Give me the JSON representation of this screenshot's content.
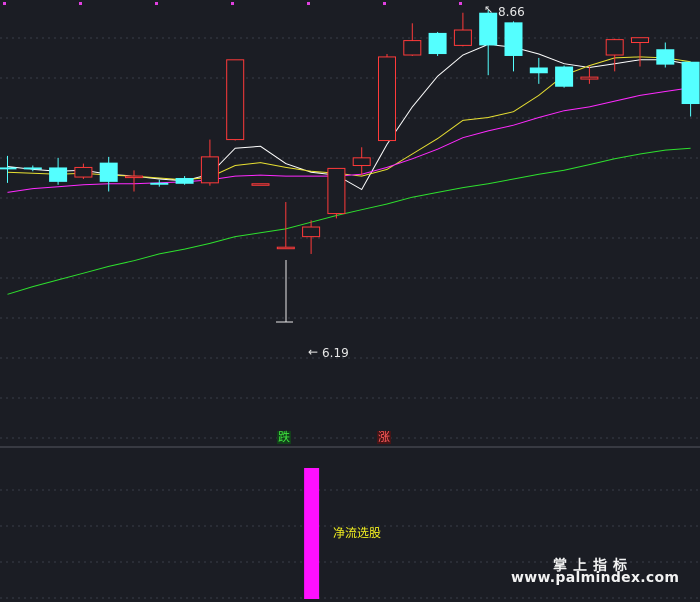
{
  "chart_data": [
    {
      "type": "candlestick",
      "title": "",
      "y_range": [
        4.6,
        8.7
      ],
      "up_color": "#ff3a3a",
      "down_color": "#54ffff",
      "candles": [
        {
          "open": 7.02,
          "close": 7.0,
          "high": 7.14,
          "low": 6.86
        },
        {
          "open": 7.02,
          "close": 7.0,
          "high": 7.04,
          "low": 6.98
        },
        {
          "open": 7.02,
          "close": 6.87,
          "high": 7.12,
          "low": 6.84
        },
        {
          "open": 6.92,
          "close": 7.02,
          "high": 7.06,
          "low": 6.9
        },
        {
          "open": 7.07,
          "close": 6.87,
          "high": 7.13,
          "low": 6.77
        },
        {
          "open": 6.92,
          "close": 6.93,
          "high": 6.99,
          "low": 6.77
        },
        {
          "open": 6.86,
          "close": 6.84,
          "high": 6.89,
          "low": 6.82
        },
        {
          "open": 6.91,
          "close": 6.85,
          "high": 6.93,
          "low": 6.84
        },
        {
          "open": 6.86,
          "close": 7.13,
          "high": 7.31,
          "low": 6.83
        },
        {
          "open": 7.31,
          "close": 8.14,
          "high": 8.14,
          "low": 7.3
        },
        {
          "open": 6.85,
          "close": 6.85,
          "high": 6.85,
          "low": 6.85
        },
        {
          "open": 6.19,
          "close": 6.19,
          "high": 6.66,
          "low": 6.19
        },
        {
          "open": 6.3,
          "close": 6.4,
          "high": 6.47,
          "low": 6.12
        },
        {
          "open": 6.54,
          "close": 7.01,
          "high": 7.01,
          "low": 6.49
        },
        {
          "open": 7.04,
          "close": 7.12,
          "high": 7.23,
          "low": 6.94
        },
        {
          "open": 7.3,
          "close": 8.17,
          "high": 8.2,
          "low": 7.3
        },
        {
          "open": 8.19,
          "close": 8.34,
          "high": 8.52,
          "low": 8.18
        },
        {
          "open": 8.42,
          "close": 8.2,
          "high": 8.43,
          "low": 8.18
        },
        {
          "open": 8.29,
          "close": 8.45,
          "high": 8.63,
          "low": 8.28
        },
        {
          "open": 8.63,
          "close": 8.29,
          "high": 8.66,
          "low": 7.98
        },
        {
          "open": 8.53,
          "close": 8.18,
          "high": 8.54,
          "low": 8.02
        },
        {
          "open": 8.06,
          "close": 8.0,
          "high": 8.16,
          "low": 7.89
        },
        {
          "open": 8.07,
          "close": 7.86,
          "high": 8.08,
          "low": 7.85
        },
        {
          "open": 7.94,
          "close": 7.96,
          "high": 8.07,
          "low": 7.89
        },
        {
          "open": 8.19,
          "close": 8.35,
          "high": 8.36,
          "low": 8.02
        },
        {
          "open": 8.32,
          "close": 8.37,
          "high": 8.37,
          "low": 8.07
        },
        {
          "open": 8.25,
          "close": 8.09,
          "high": 8.32,
          "low": 8.06
        },
        {
          "open": 8.12,
          "close": 7.68,
          "high": 8.12,
          "low": 7.55
        }
      ],
      "series": [
        {
          "color": "#ffffff",
          "values": [
            7.03,
            7.0,
            6.98,
            6.99,
            6.95,
            6.93,
            6.9,
            6.88,
            6.95,
            7.22,
            7.24,
            7.06,
            6.97,
            6.94,
            6.79,
            7.26,
            7.65,
            7.97,
            8.19,
            8.3,
            8.27,
            8.2,
            8.1,
            8.06,
            8.1,
            8.14,
            8.14,
            8.09
          ]
        },
        {
          "color": "#e8e032",
          "values": [
            6.97,
            6.96,
            6.95,
            6.96,
            6.94,
            6.93,
            6.91,
            6.89,
            6.92,
            7.04,
            7.07,
            7.02,
            6.98,
            6.96,
            6.93,
            7.0,
            7.16,
            7.32,
            7.51,
            7.54,
            7.6,
            7.77,
            7.98,
            8.08,
            8.16,
            8.17,
            8.16,
            8.12
          ]
        },
        {
          "color": "#ff2aff",
          "values": [
            6.76,
            6.8,
            6.82,
            6.84,
            6.85,
            6.85,
            6.86,
            6.87,
            6.89,
            6.93,
            6.94,
            6.93,
            6.93,
            6.93,
            6.95,
            7.02,
            7.11,
            7.21,
            7.33,
            7.4,
            7.46,
            7.54,
            7.61,
            7.65,
            7.71,
            7.77,
            7.81,
            7.85
          ]
        },
        {
          "color": "#2ee02e",
          "values": [
            5.7,
            5.78,
            5.85,
            5.92,
            5.99,
            6.05,
            6.12,
            6.17,
            6.23,
            6.3,
            6.34,
            6.38,
            6.45,
            6.52,
            6.58,
            6.64,
            6.71,
            6.76,
            6.81,
            6.85,
            6.9,
            6.95,
            6.99,
            7.05,
            7.11,
            7.16,
            7.2,
            7.22
          ]
        }
      ],
      "high_marker": "8.66",
      "low_marker": "6.19",
      "signal_tags": {
        "down": "跌",
        "up": "涨"
      }
    },
    {
      "type": "bar",
      "indicator_label": "净流选股",
      "bar_color": "#ff10ff",
      "bars": [
        {
          "index": 12,
          "value": 1
        }
      ]
    }
  ],
  "watermark": {
    "title": "掌上指标",
    "url": "www.palmindex.com"
  }
}
